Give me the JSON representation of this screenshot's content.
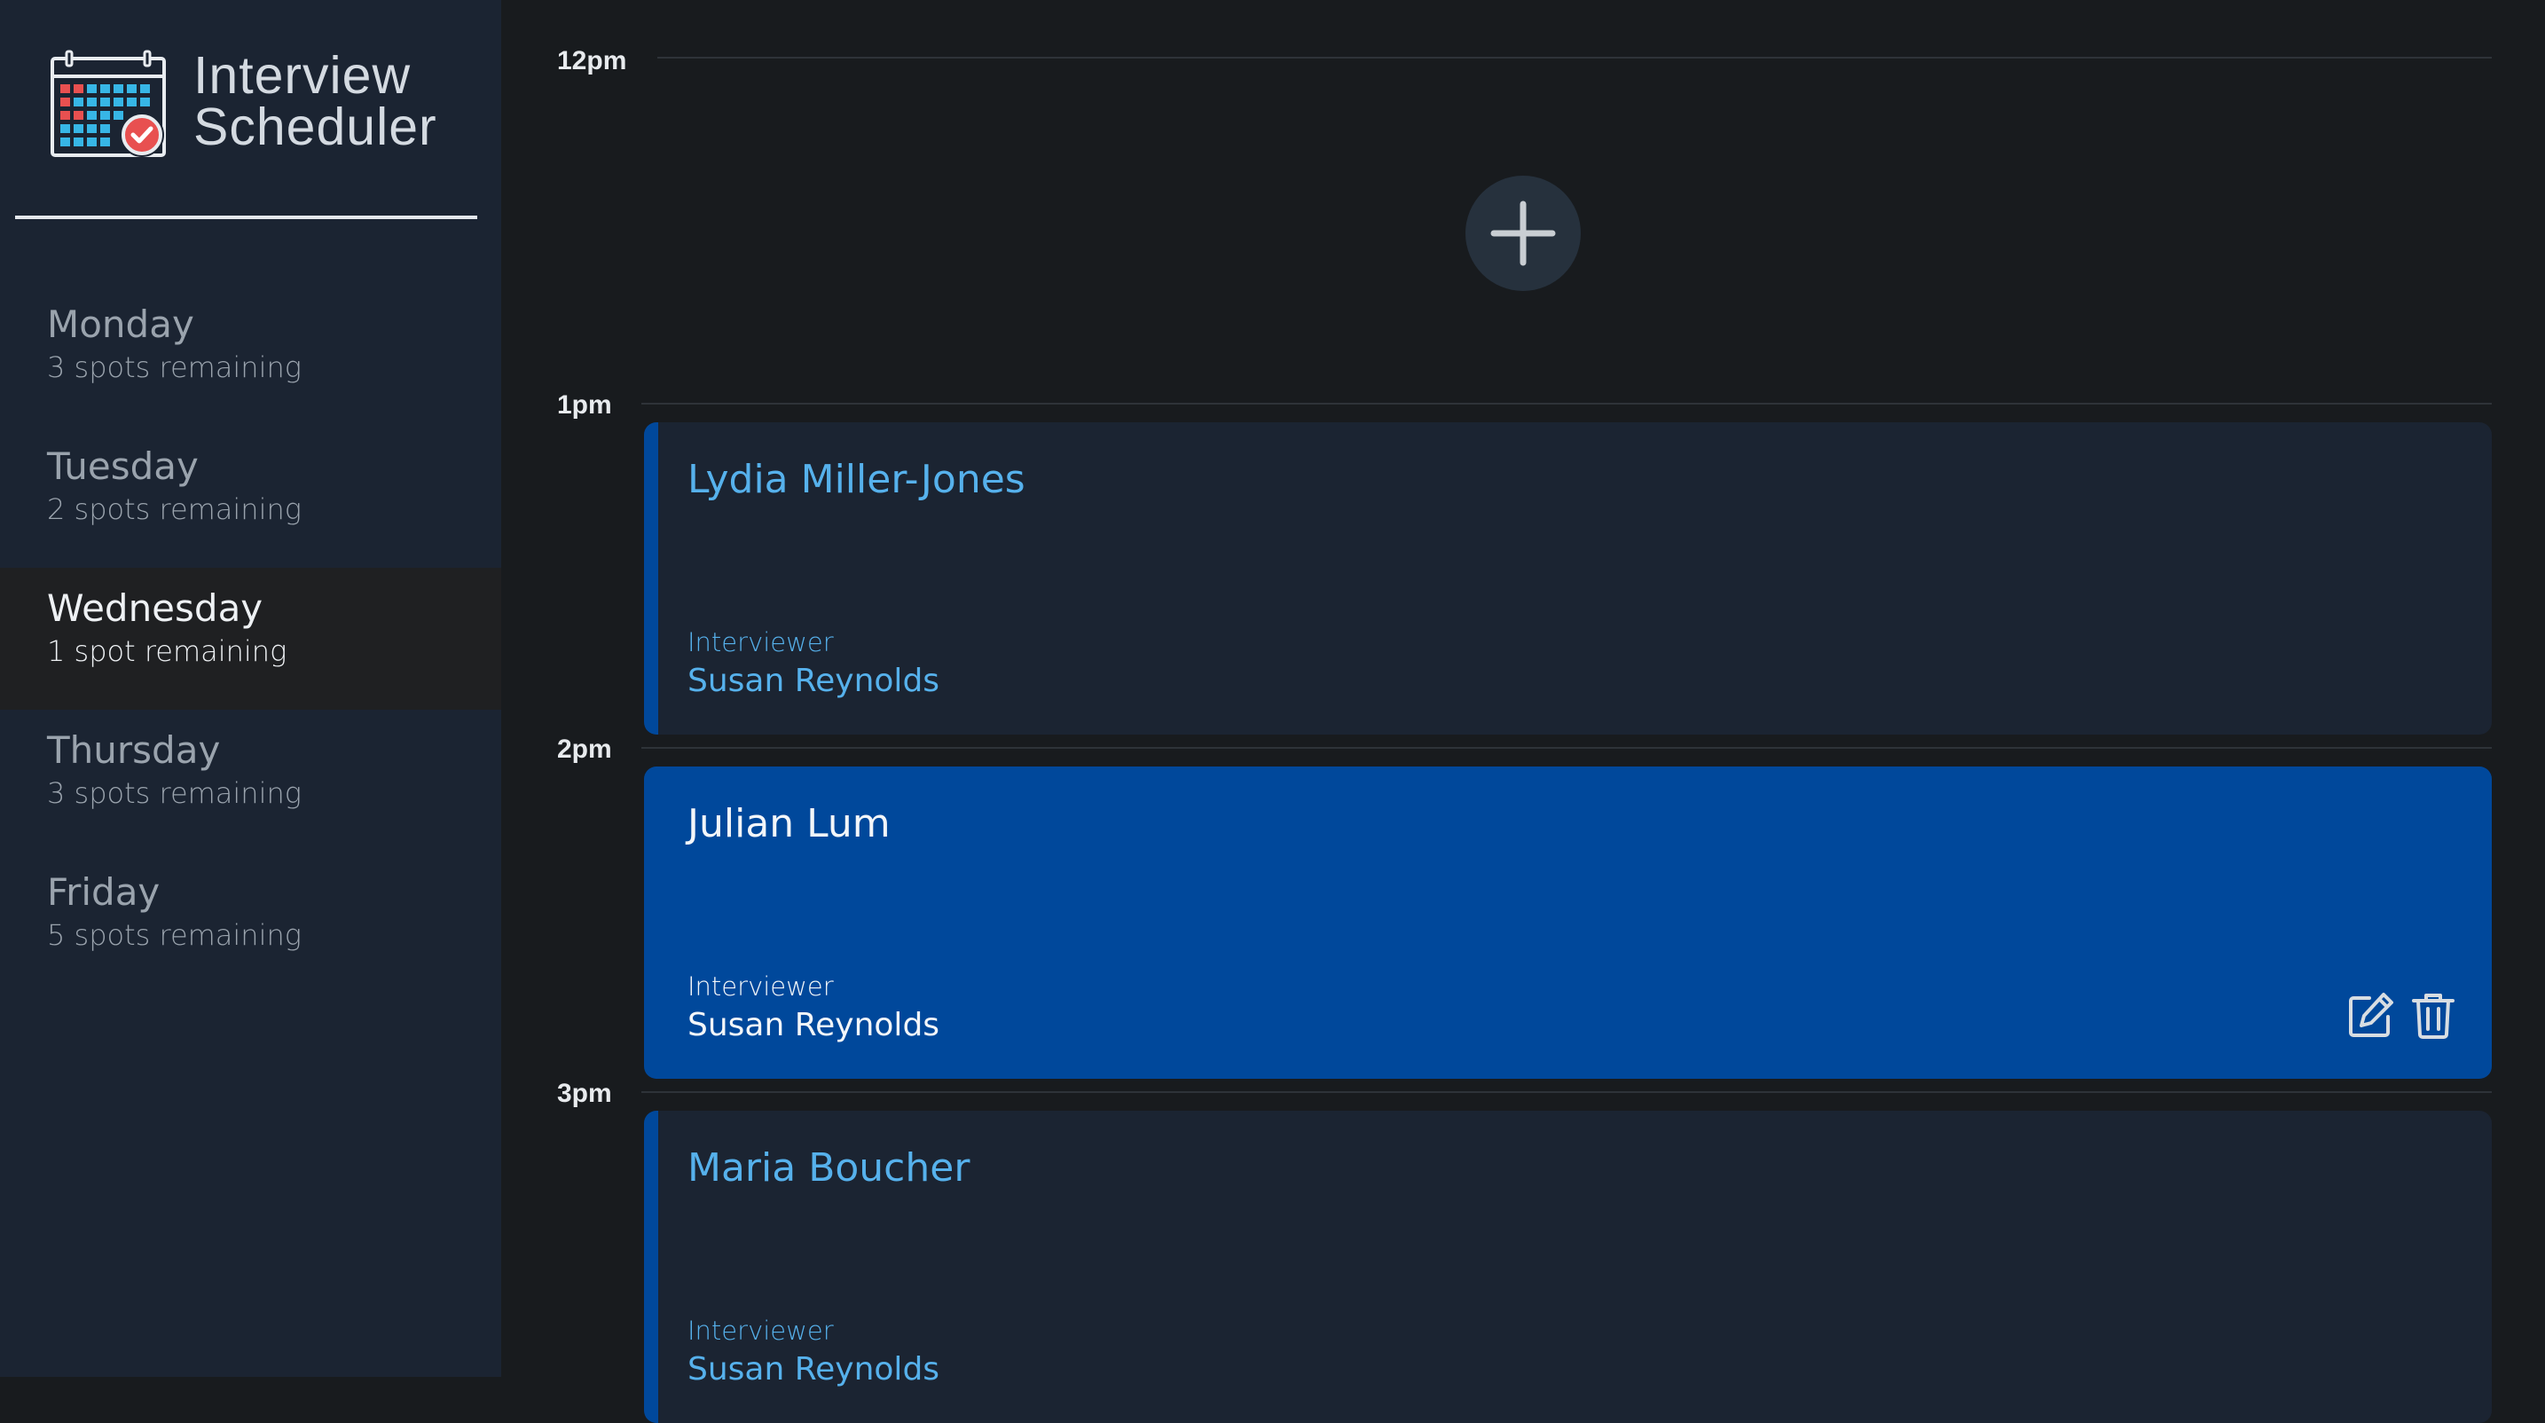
{
  "app": {
    "title_line1": "Interview",
    "title_line2": "Scheduler"
  },
  "sidebar": {
    "days": [
      {
        "name": "Monday",
        "spots": "3 spots remaining",
        "selected": false
      },
      {
        "name": "Tuesday",
        "spots": "2 spots remaining",
        "selected": false
      },
      {
        "name": "Wednesday",
        "spots": "1 spot remaining",
        "selected": true
      },
      {
        "name": "Thursday",
        "spots": "3 spots remaining",
        "selected": false
      },
      {
        "name": "Friday",
        "spots": "5 spots remaining",
        "selected": false
      }
    ]
  },
  "schedule": {
    "slots": [
      {
        "time": "12pm",
        "empty": true
      },
      {
        "time": "1pm",
        "student": "Lydia Miller-Jones",
        "interviewer_label": "Interviewer",
        "interviewer": "Susan Reynolds",
        "active": false
      },
      {
        "time": "2pm",
        "student": "Julian Lum",
        "interviewer_label": "Interviewer",
        "interviewer": "Susan Reynolds",
        "active": true
      },
      {
        "time": "3pm",
        "student": "Maria Boucher",
        "interviewer_label": "Interviewer",
        "interviewer": "Susan Reynolds",
        "active": false
      }
    ]
  },
  "icons": {
    "logo": "calendar-check-icon",
    "add": "plus-icon",
    "edit": "edit-icon",
    "delete": "trash-icon"
  },
  "colors": {
    "sidebar_bg": "#1b2432",
    "main_bg": "#181b1e",
    "accent_blue": "#00489b",
    "link_blue": "#56b1ec",
    "logo_red": "#e85050",
    "logo_cyan": "#37b6e6"
  }
}
